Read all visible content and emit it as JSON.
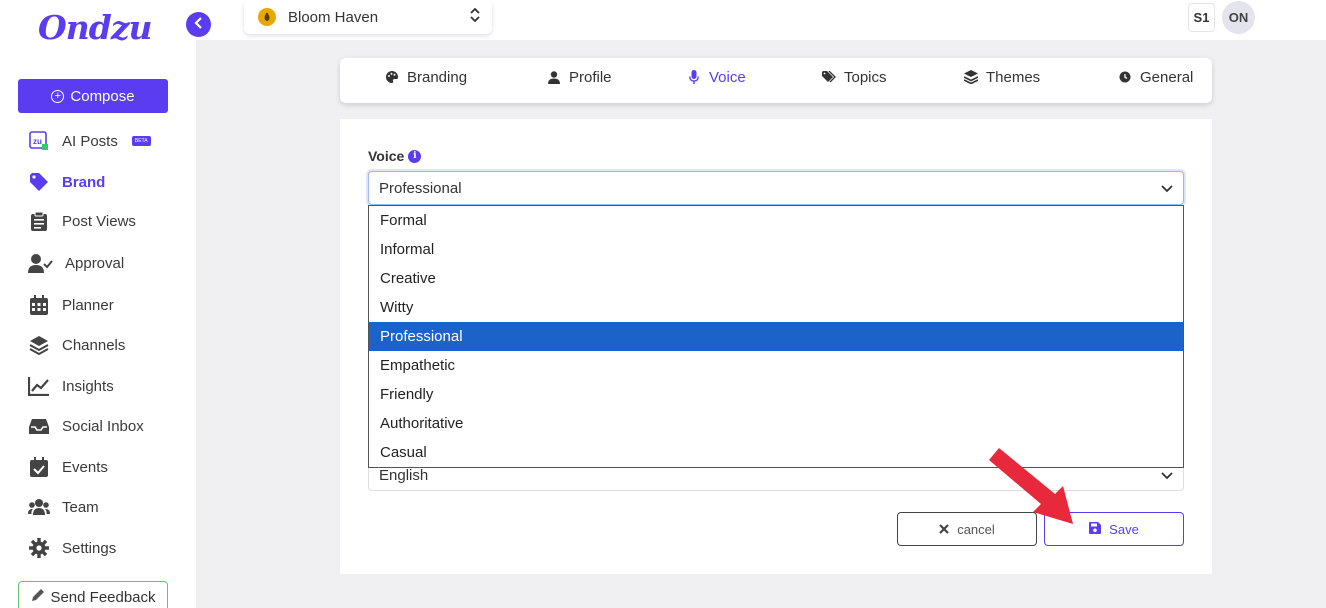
{
  "app": {
    "logo": "Ondzu"
  },
  "sidebar": {
    "compose_label": "Compose",
    "items": [
      {
        "label": "AI Posts",
        "icon": "zu-ai-icon",
        "badge": "BETA"
      },
      {
        "label": "Brand",
        "icon": "tag-icon",
        "active": true
      },
      {
        "label": "Post Views",
        "icon": "clipboard-icon"
      },
      {
        "label": "Approval",
        "icon": "user-check-icon"
      },
      {
        "label": "Planner",
        "icon": "calendar-icon"
      },
      {
        "label": "Channels",
        "icon": "layers-icon"
      },
      {
        "label": "Insights",
        "icon": "chart-line-icon"
      },
      {
        "label": "Social Inbox",
        "icon": "inbox-icon"
      },
      {
        "label": "Events",
        "icon": "calendar-check-icon"
      },
      {
        "label": "Team",
        "icon": "users-icon"
      },
      {
        "label": "Settings",
        "icon": "gear-icon"
      }
    ],
    "feedback_label": "Send Feedback"
  },
  "topbar": {
    "brand_name": "Bloom Haven",
    "user_initials_1": "S1",
    "user_initials_2": "ON"
  },
  "tabs": [
    {
      "label": "Branding",
      "icon": "palette-icon"
    },
    {
      "label": "Profile",
      "icon": "user-icon"
    },
    {
      "label": "Voice",
      "icon": "microphone-icon",
      "active": true
    },
    {
      "label": "Topics",
      "icon": "tags-icon"
    },
    {
      "label": "Themes",
      "icon": "layers-icon"
    },
    {
      "label": "General",
      "icon": "clock-icon"
    }
  ],
  "form": {
    "voice_label": "Voice",
    "voice_value": "Professional",
    "voice_options": [
      "Formal",
      "Informal",
      "Creative",
      "Witty",
      "Professional",
      "Empathetic",
      "Friendly",
      "Authoritative",
      "Casual"
    ],
    "selected_option": "Professional",
    "language_value": "English",
    "cancel_label": "cancel",
    "save_label": "Save"
  },
  "colors": {
    "accent": "#5b3cf0",
    "selected": "#1b62c9",
    "annotation_arrow": "#e8293b"
  }
}
